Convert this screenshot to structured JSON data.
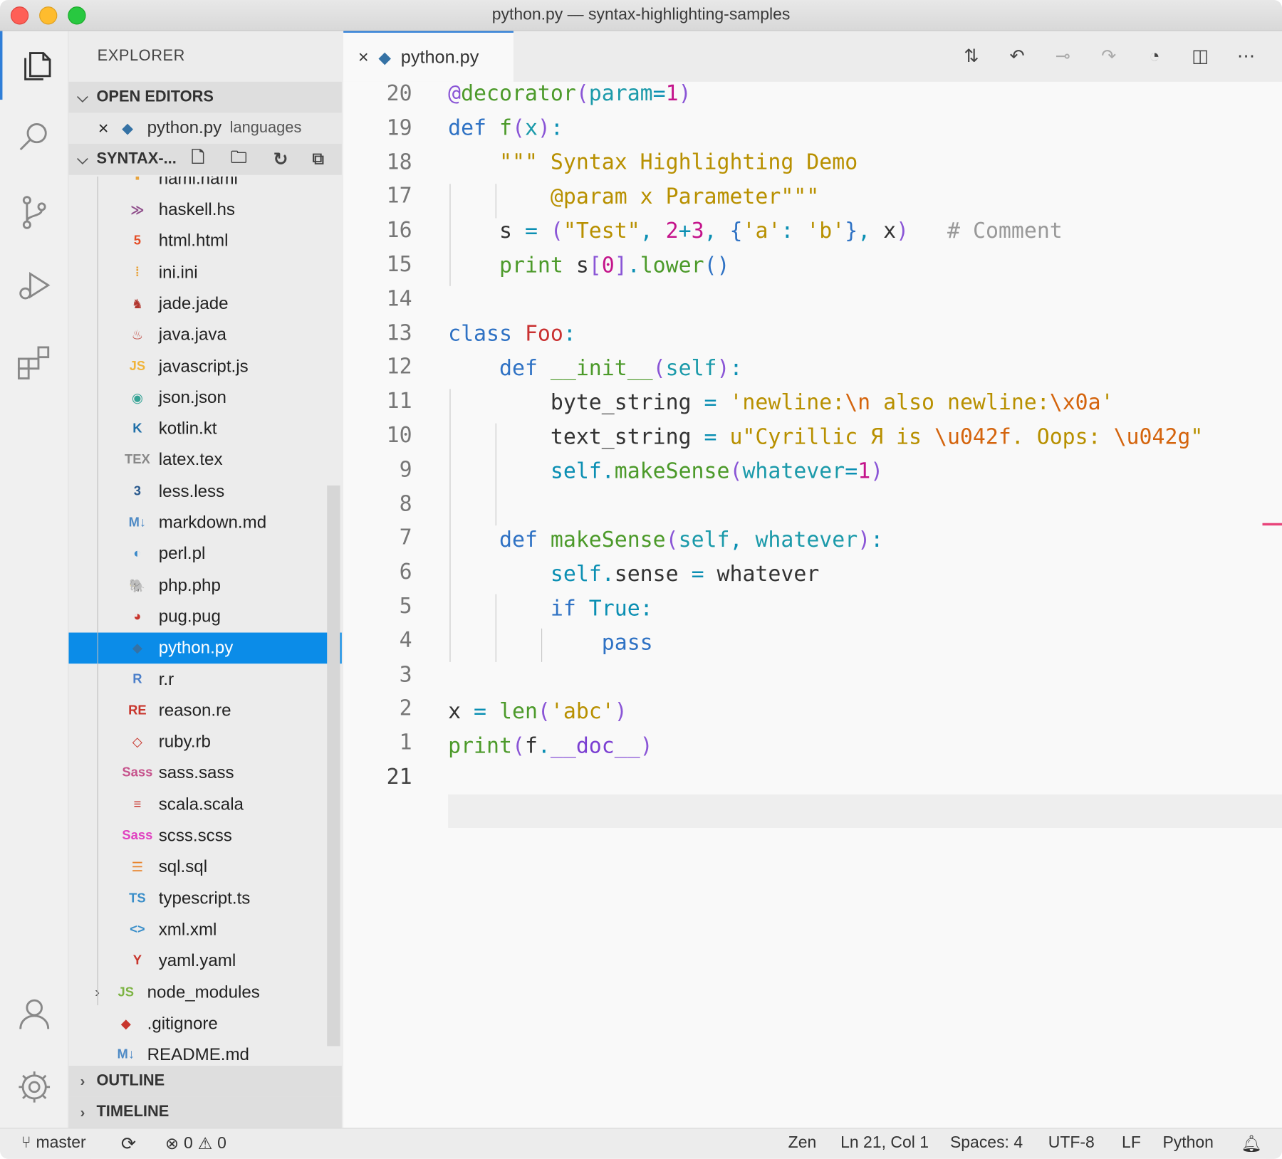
{
  "window": {
    "title": "python.py — syntax-highlighting-samples"
  },
  "sidebar": {
    "title": "EXPLORER",
    "open_editors": {
      "label": "OPEN EDITORS",
      "file": "python.py",
      "desc": "languages"
    },
    "folder": {
      "label": "SYNTAX-..."
    },
    "partial_top": "haml.haml",
    "files": [
      {
        "name": "haskell.hs",
        "icon": "haskell-icon",
        "color": "#8f4e8b",
        "glyph": "≫"
      },
      {
        "name": "html.html",
        "icon": "html-icon",
        "color": "#e44d26",
        "glyph": "5"
      },
      {
        "name": "ini.ini",
        "icon": "ini-icon",
        "color": "#e8a33d",
        "glyph": "⁞"
      },
      {
        "name": "jade.jade",
        "icon": "jade-icon",
        "color": "#b2372f",
        "glyph": "♞"
      },
      {
        "name": "java.java",
        "icon": "java-icon",
        "color": "#c4534b",
        "glyph": "♨"
      },
      {
        "name": "javascript.js",
        "icon": "javascript-icon",
        "color": "#f0b43a",
        "glyph": "JS"
      },
      {
        "name": "json.json",
        "icon": "json-icon",
        "color": "#35a395",
        "glyph": "◉"
      },
      {
        "name": "kotlin.kt",
        "icon": "kotlin-icon",
        "color": "#1f6fa8",
        "glyph": "K"
      },
      {
        "name": "latex.tex",
        "icon": "latex-icon",
        "color": "#888888",
        "glyph": "TEX"
      },
      {
        "name": "less.less",
        "icon": "less-icon",
        "color": "#2a5a8e",
        "glyph": "3"
      },
      {
        "name": "markdown.md",
        "icon": "markdown-icon",
        "color": "#4e8ac5",
        "glyph": "M↓"
      },
      {
        "name": "perl.pl",
        "icon": "perl-icon",
        "color": "#3a89c9",
        "glyph": "◐"
      },
      {
        "name": "php.php",
        "icon": "php-icon",
        "color": "#3c6f9c",
        "glyph": "🐘"
      },
      {
        "name": "pug.pug",
        "icon": "pug-icon",
        "color": "#c8352c",
        "glyph": "◕"
      },
      {
        "name": "python.py",
        "icon": "python-icon",
        "color": "#3572a5",
        "glyph": "◆"
      },
      {
        "name": "r.r",
        "icon": "r-icon",
        "color": "#4a7ec9",
        "glyph": "R"
      },
      {
        "name": "reason.re",
        "icon": "reason-icon",
        "color": "#c8352c",
        "glyph": "RE"
      },
      {
        "name": "ruby.rb",
        "icon": "ruby-icon",
        "color": "#c8352c",
        "glyph": "◇"
      },
      {
        "name": "sass.sass",
        "icon": "sass-icon",
        "color": "#c6538c",
        "glyph": "Sass"
      },
      {
        "name": "scala.scala",
        "icon": "scala-icon",
        "color": "#c8352c",
        "glyph": "≡"
      },
      {
        "name": "scss.scss",
        "icon": "scss-icon",
        "color": "#e040c0",
        "glyph": "Sass"
      },
      {
        "name": "sql.sql",
        "icon": "database-icon",
        "color": "#e8842c",
        "glyph": "☰"
      },
      {
        "name": "typescript.ts",
        "icon": "typescript-icon",
        "color": "#3a8ec9",
        "glyph": "TS"
      },
      {
        "name": "xml.xml",
        "icon": "xml-icon",
        "color": "#3a8ec9",
        "glyph": "<>"
      },
      {
        "name": "yaml.yaml",
        "icon": "yaml-icon",
        "color": "#c8352c",
        "glyph": "Y"
      }
    ],
    "top_items": [
      {
        "name": "node_modules",
        "icon": "nodejs-icon",
        "color": "#7cb342",
        "glyph": "JS",
        "folder": true
      },
      {
        "name": ".gitignore",
        "icon": "git-icon",
        "color": "#c8352c",
        "glyph": "◆"
      },
      {
        "name": "README.md",
        "icon": "markdown-icon",
        "color": "#4e8ac5",
        "glyph": "M↓"
      }
    ],
    "outline": "OUTLINE",
    "timeline": "TIMELINE"
  },
  "editor": {
    "tab_label": "python.py",
    "line_numbers": [
      "20",
      "19",
      "18",
      "17",
      "16",
      "15",
      "14",
      "13",
      "12",
      "11",
      "10",
      "9",
      "8",
      "7",
      "6",
      "5",
      "4",
      "3",
      "2",
      "1",
      "21"
    ]
  },
  "status": {
    "branch": "master",
    "errors": "0",
    "warnings": "0",
    "mode": "Zen",
    "position": "Ln 21, Col 1",
    "spaces": "Spaces: 4",
    "encoding": "UTF-8",
    "eol": "LF",
    "language": "Python"
  },
  "colors": {
    "accent": "#0b8ce8",
    "active_border": "#2f7ed8",
    "marker": "#e8447a"
  }
}
